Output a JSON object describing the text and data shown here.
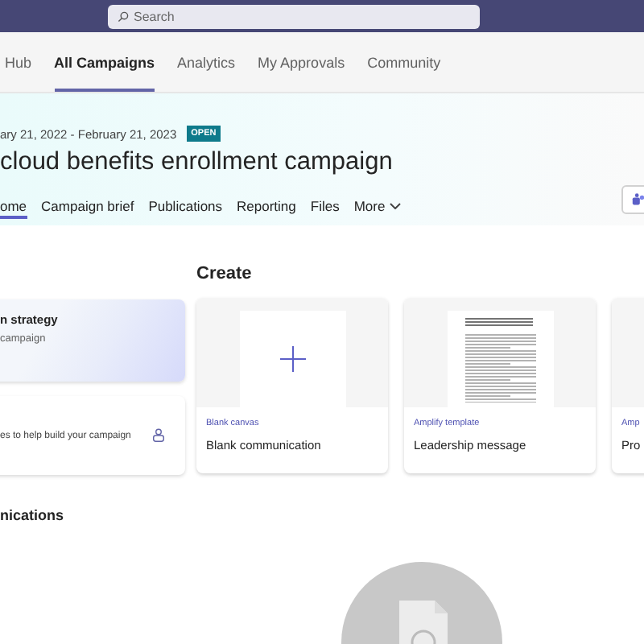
{
  "search": {
    "placeholder": "Search"
  },
  "nav": [
    {
      "label": "Hub",
      "selected": false
    },
    {
      "label": "All Campaigns",
      "selected": true
    },
    {
      "label": "Analytics",
      "selected": false
    },
    {
      "label": "My Approvals",
      "selected": false
    },
    {
      "label": "Community",
      "selected": false
    }
  ],
  "campaign": {
    "dates": "ary 21, 2022 - February 21, 2023",
    "status": "OPEN",
    "title": "cloud benefits enrollment campaign"
  },
  "tabs": [
    {
      "label": "ome",
      "selected": true
    },
    {
      "label": "Campaign brief",
      "selected": false
    },
    {
      "label": "Publications",
      "selected": false
    },
    {
      "label": "Reporting",
      "selected": false
    },
    {
      "label": "Files",
      "selected": false
    },
    {
      "label": "More",
      "selected": false,
      "dropdown": true
    }
  ],
  "side_cards": [
    {
      "kind": "banner",
      "title": "n strategy",
      "subtitle": "campaign"
    },
    {
      "kind": "tip",
      "text": "es to help build your campaign"
    }
  ],
  "create": {
    "heading": "Create",
    "cards": [
      {
        "kind": "blank",
        "tag": "Blank canvas",
        "title": "Blank communication"
      },
      {
        "kind": "template",
        "tag": "Amplify template",
        "title": "Leadership message"
      },
      {
        "kind": "partial",
        "tag": "Amp",
        "title": "Pro"
      }
    ]
  },
  "communications": {
    "heading": "nications"
  }
}
